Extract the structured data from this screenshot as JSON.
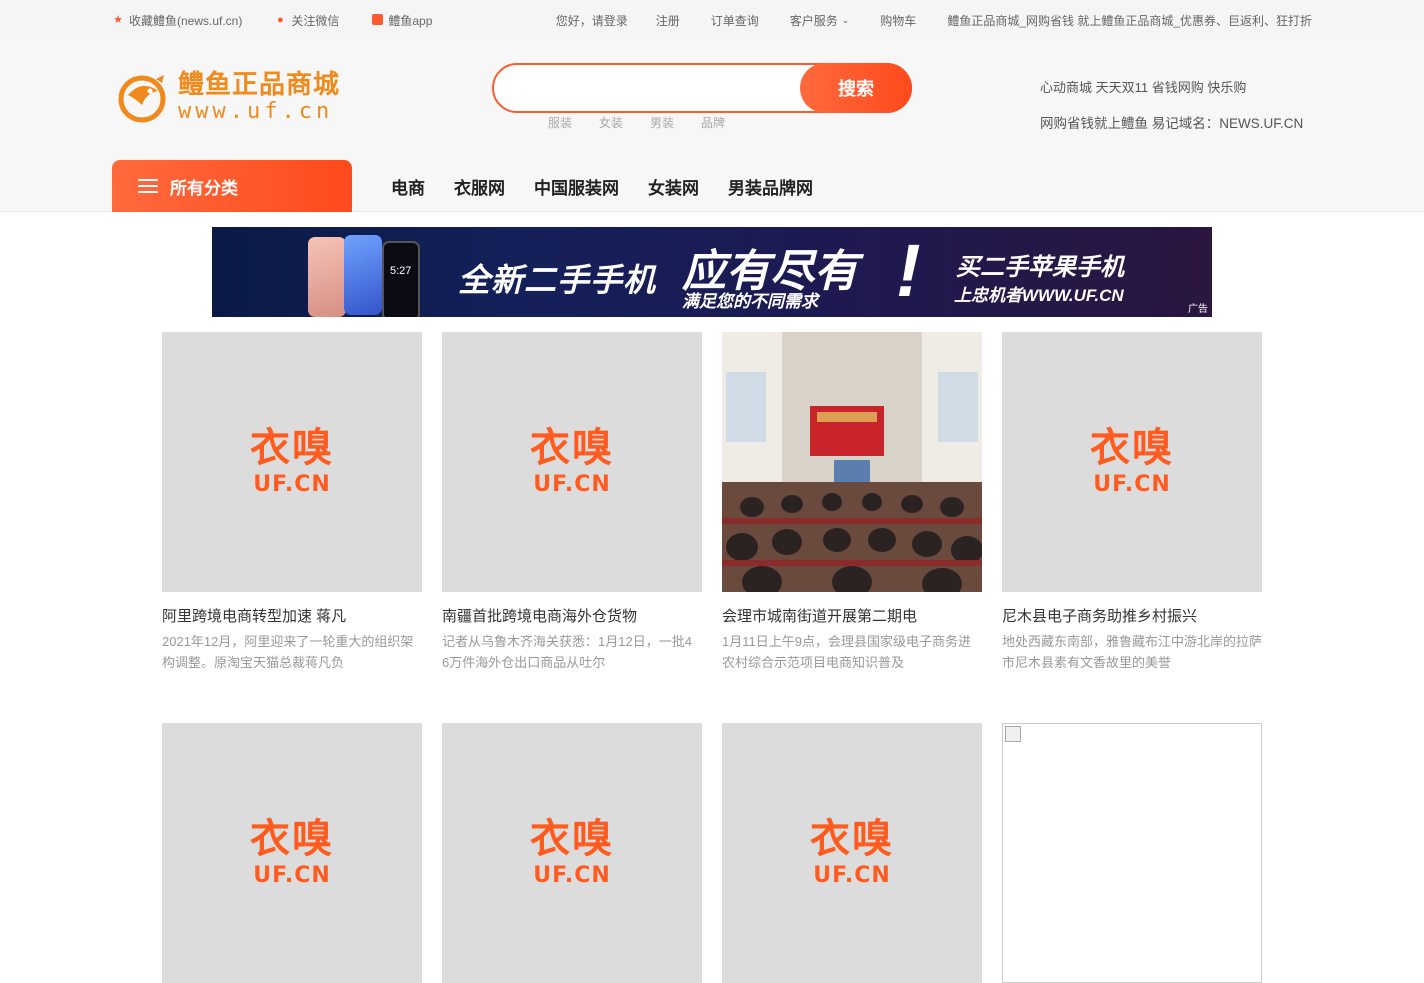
{
  "topbar": {
    "bookmark": "收藏鳢鱼(news.uf.cn)",
    "wechat": "关注微信",
    "app": "鳢鱼app",
    "greeting": "您好，请登录",
    "register": "注册",
    "orders": "订单查询",
    "service": "客户服务",
    "cart": "购物车",
    "promo": "鳢鱼正品商城_网购省钱 就上鳢鱼正品商城_优惠券、巨返利、狂打折"
  },
  "logo": {
    "cn": "鳢鱼正品商城",
    "url": "www.uf.cn"
  },
  "search": {
    "placeholder": "",
    "button": "搜索",
    "hot_words": [
      "服装",
      "女装",
      "男装",
      "品牌"
    ]
  },
  "slogan": {
    "line1": "心动商城 天天双11 省钱网购 快乐购",
    "line2": "网购省钱就上鳢鱼 易记域名：NEWS.UF.CN"
  },
  "nav": {
    "all_categories": "所有分类",
    "links": [
      "电商",
      "衣服网",
      "中国服装网",
      "女装网",
      "男装品牌网"
    ]
  },
  "banner": {
    "phone_time": "5:27",
    "main": "全新二手手机",
    "big": "应有尽有",
    "sub": "满足您的不同需求",
    "bang": "!",
    "right1": "买二手苹果手机",
    "right2": "上忠机者WWW.UF.CN",
    "ad": "广告"
  },
  "placeholder": {
    "cn": "衣嗅",
    "en": "UF.CN"
  },
  "articles": [
    {
      "title": "阿里跨境电商转型加速 蒋凡",
      "desc": "2021年12月，阿里迎来了一轮重大的组织架构调整。原淘宝天猫总裁蒋凡负",
      "image": "placeholder"
    },
    {
      "title": "南疆首批跨境电商海外仓货物",
      "desc": "记者从乌鲁木齐海关获悉：1月12日，一批4 6万件海外仓出口商品从吐尔",
      "image": "placeholder"
    },
    {
      "title": "会理市城南街道开展第二期电",
      "desc": "1月11日上午9点，会理县国家级电子商务进农村综合示范项目电商知识普及",
      "image": "photo"
    },
    {
      "title": "尼木县电子商务助推乡村振兴",
      "desc": "地处西藏东南部，雅鲁藏布江中游北岸的拉萨市尼木县素有文香故里的美誉",
      "image": "placeholder"
    },
    {
      "title": "",
      "desc": "",
      "image": "placeholder"
    },
    {
      "title": "",
      "desc": "",
      "image": "placeholder"
    },
    {
      "title": "",
      "desc": "",
      "image": "placeholder"
    },
    {
      "title": "",
      "desc": "",
      "image": "broken"
    }
  ],
  "colors": {
    "accent": "#ff5b2e",
    "logo": "#f08a1c",
    "topbar_bg": "#f5f5f5"
  }
}
